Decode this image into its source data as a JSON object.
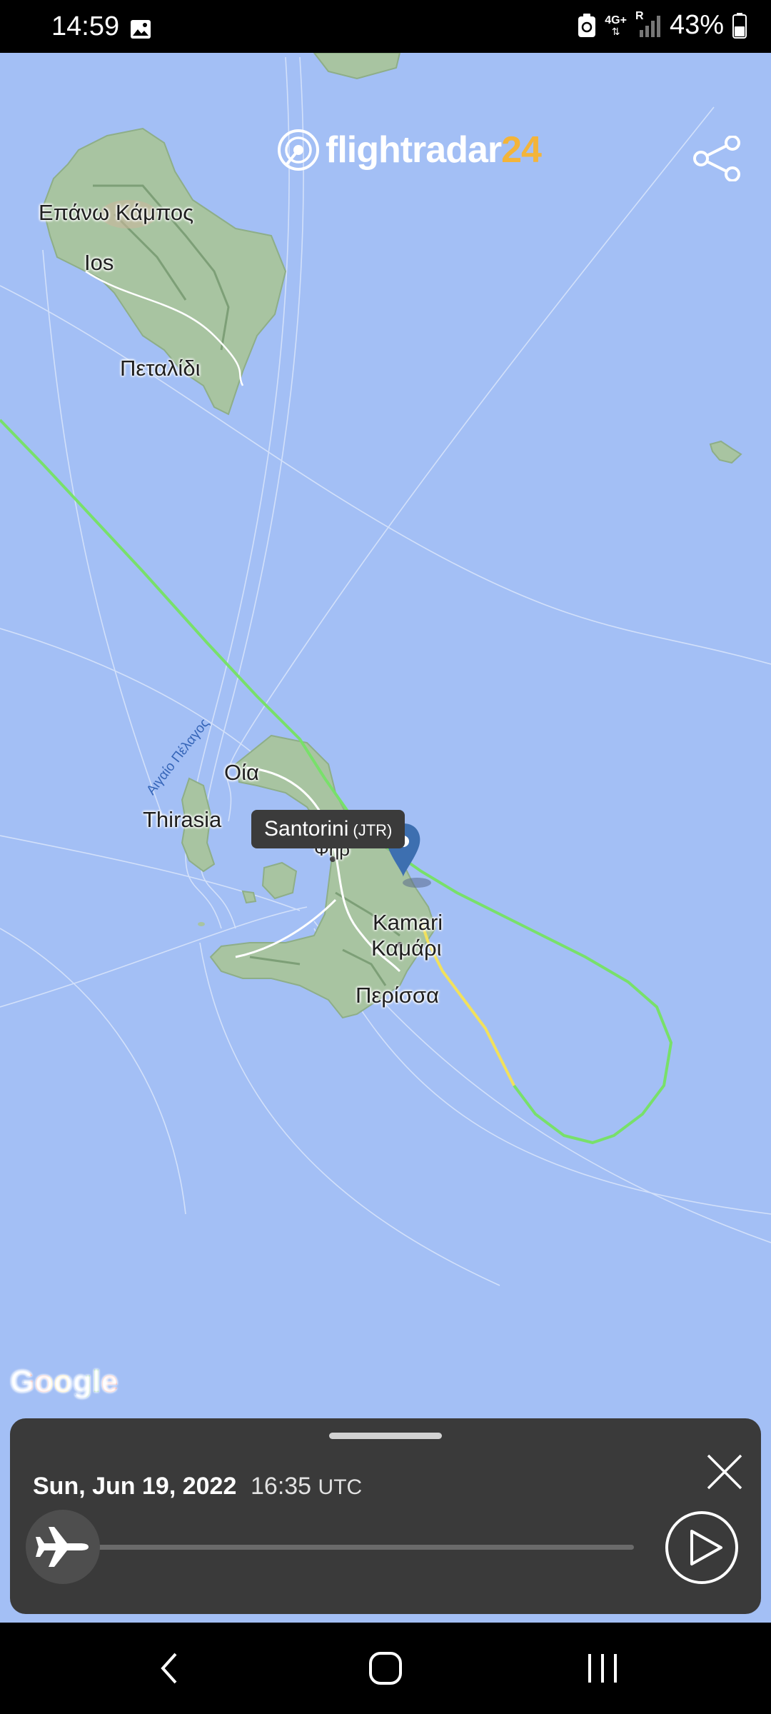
{
  "status_bar": {
    "time": "14:59",
    "network": "4G+",
    "roaming": "R",
    "battery": "43%",
    "icons": [
      "image-icon",
      "recycle-icon",
      "signal-icon",
      "battery-icon"
    ]
  },
  "header": {
    "logo_text": "flightradar",
    "logo_number": "24",
    "share_icon": "share-icon"
  },
  "map": {
    "labels": {
      "pano_kampos": "Επάνω Κάμπος",
      "ios": "Ios",
      "petalidi": "Πεταλίδι",
      "sea": "Αιγαίο Πέλαγος",
      "oia": "Οία",
      "thirasia": "Thirasia",
      "kamari_latin": "Kamari",
      "kamari_greek": "Καμάρι",
      "perissa": "Περίσσα",
      "fira_partial": "Φηρ"
    },
    "airport": {
      "name": "Santorini",
      "code": "(JTR)"
    },
    "attribution": "Google",
    "colors": {
      "water": "#a3bff5",
      "track_green": "#78e06a",
      "track_yellow": "#f2e15c",
      "pin": "#3d6fb0"
    }
  },
  "playback": {
    "date": "Sun, Jun 19, 2022",
    "time": "16:35",
    "timezone": "UTC",
    "progress": 0,
    "close_icon": "close-icon",
    "play_icon": "play-icon",
    "thumb_icon": "airplane-icon"
  },
  "nav_bar": {
    "back_icon": "back-icon",
    "home_icon": "home-icon",
    "recents_icon": "recents-icon"
  }
}
